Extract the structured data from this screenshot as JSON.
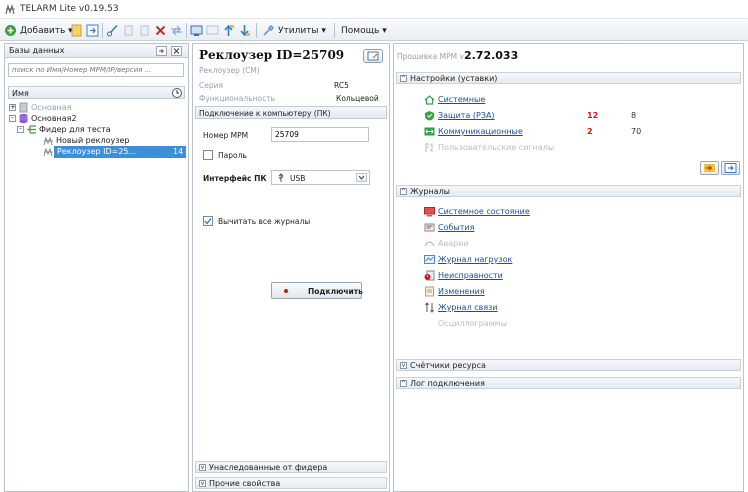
{
  "window": {
    "title": "TELARM Lite v0.19.53"
  },
  "toolbar": {
    "add": "Добавить ▾",
    "utils": "Утилиты ▾",
    "help": "Помощь ▾"
  },
  "left": {
    "header": "Базы данных",
    "search_placeholder": "поиск по Имя/Номер МРМ/IP/версия ...",
    "col_name": "Имя",
    "tree": [
      "Основная",
      "Основная2",
      "Фидер для теста",
      "Новый реклоузер",
      "Реклоузер ID=25...",
      "14"
    ]
  },
  "device": {
    "title": "Реклоузер ID=25709",
    "subtitle": "Реклоузер (СМ)",
    "series_label": "Серия",
    "series_value": "RC5",
    "func_label": "Функциональность",
    "func_value": "Кольцевой",
    "conn_section": "Подключение к компьютеру (ПК)",
    "mpm_label": "Номер МРМ",
    "mpm_value": "25709",
    "password_label": "Пароль",
    "iface_label": "Интерфейс ПК",
    "iface_value": "USB",
    "read_logs_label": "Вычитать все журналы",
    "connect_label": "Подключить",
    "inherited_label": "Унаследованные от фидера",
    "other_props_label": "Прочие свойства"
  },
  "right": {
    "firmware_label": "Прошивка МРМ v",
    "firmware_version": "2.72.033",
    "settings_section": "Настройки (уставки)",
    "settings": [
      {
        "label": "Системные",
        "a": "",
        "b": ""
      },
      {
        "label": "Защита (РЗА)",
        "a": "12",
        "b": "8"
      },
      {
        "label": "Коммуникационные",
        "a": "2",
        "b": "70"
      },
      {
        "label": "Пользовательские сигналы",
        "a": "",
        "b": ""
      }
    ],
    "journals_section": "Журналы",
    "journals": [
      "Системное состояние",
      "События",
      "Аварии",
      "Журнал нагрузок",
      "Неисправности",
      "Изменения",
      "Журнал связи",
      "Осциллограммы"
    ],
    "counters_section": "Счётчики ресурса",
    "log_section": "Лог подключения"
  },
  "colors": {
    "accent_red": "#d01818",
    "link": "#1a4fa0",
    "selection": "#3f8fd8"
  }
}
